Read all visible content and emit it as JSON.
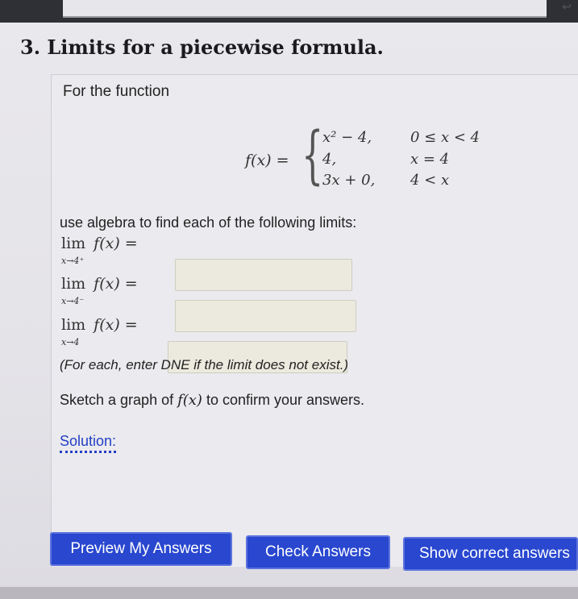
{
  "problem": {
    "title": "3. Limits for a piecewise formula.",
    "intro": "For the function",
    "function_label": "f(x) =",
    "cases": [
      {
        "expr": "x² − 4,",
        "cond": "0 ≤ x < 4"
      },
      {
        "expr": "4,",
        "cond": "x = 4"
      },
      {
        "expr": "3x + 0,",
        "cond": "4 < x"
      }
    ],
    "instruction": "use algebra to find each of the following limits:",
    "limits": [
      {
        "lim": "lim",
        "func": "f(x) =",
        "sub": "x→4⁺",
        "value": ""
      },
      {
        "lim": "lim",
        "func": "f(x) =",
        "sub": "x→4⁻",
        "value": ""
      },
      {
        "lim": "lim",
        "func": "f(x) =",
        "sub": "x→4",
        "value": ""
      }
    ],
    "hint": "(For each, enter DNE if the limit does not exist.)",
    "sketch_pre": "Sketch a graph of ",
    "sketch_math": "f(x)",
    "sketch_post": " to confirm your answers.",
    "solution_link": "Solution:"
  },
  "buttons": {
    "preview": "Preview My Answers",
    "check": "Check Answers",
    "show": "Show correct answers"
  },
  "colors": {
    "button_blue": "#2947cf",
    "link_blue": "#233fc4"
  }
}
